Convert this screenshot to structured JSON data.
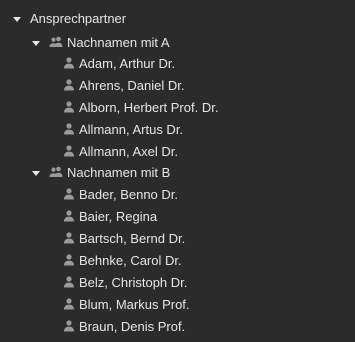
{
  "tree": {
    "root": {
      "label": "Ansprechpartner",
      "icon": "caret-down-icon"
    },
    "groups": [
      {
        "label": "Nachnamen mit A",
        "icon": "group-icon",
        "children": [
          {
            "label": "Adam, Arthur Dr.",
            "icon": "person-icon"
          },
          {
            "label": "Ahrens, Daniel Dr.",
            "icon": "person-icon"
          },
          {
            "label": "Alborn, Herbert Prof. Dr.",
            "icon": "person-icon"
          },
          {
            "label": "Allmann, Artus Dr.",
            "icon": "person-icon"
          },
          {
            "label": "Allmann, Axel Dr.",
            "icon": "person-icon"
          }
        ]
      },
      {
        "label": "Nachnamen mit B",
        "icon": "group-icon",
        "children": [
          {
            "label": "Bader, Benno Dr.",
            "icon": "person-icon"
          },
          {
            "label": "Baier, Regina",
            "icon": "person-icon"
          },
          {
            "label": "Bartsch, Bernd Dr.",
            "icon": "person-icon"
          },
          {
            "label": "Behnke, Carol Dr.",
            "icon": "person-icon"
          },
          {
            "label": "Belz, Christoph Dr.",
            "icon": "person-icon"
          },
          {
            "label": "Blum, Markus Prof.",
            "icon": "person-icon"
          },
          {
            "label": "Braun, Denis Prof.",
            "icon": "person-icon"
          }
        ]
      }
    ]
  },
  "colors": {
    "background": "#2b2b2b",
    "text": "#e6e6e6",
    "icon": "#9a9a9a"
  }
}
